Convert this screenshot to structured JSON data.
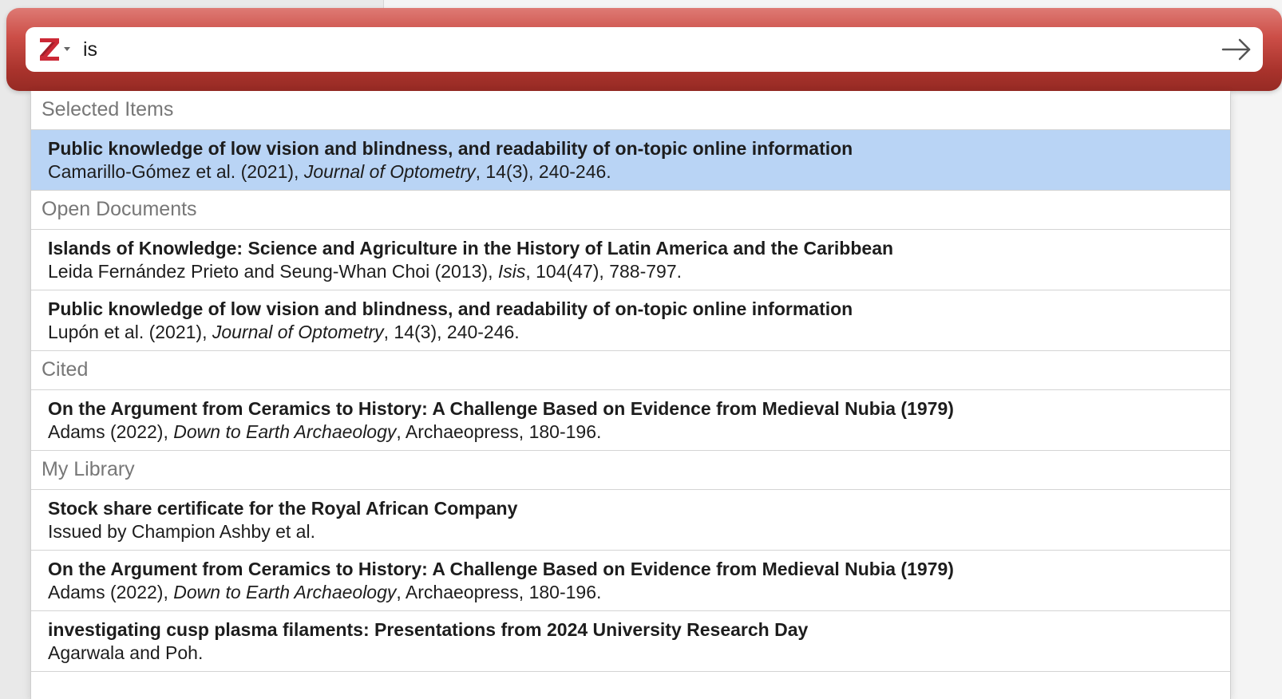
{
  "search": {
    "value": "is"
  },
  "sections": [
    {
      "header": "Selected Items",
      "items": [
        {
          "title": "Public knowledge of low vision and blindness, and readability of on-topic online information",
          "authors": "Camarillo-Gómez et al. (2021), ",
          "publication": "Journal of Optometry",
          "rest": ", 14(3), 240-246.",
          "selected": true
        }
      ]
    },
    {
      "header": "Open Documents",
      "items": [
        {
          "title": "Islands of Knowledge: Science and Agriculture in the History of Latin America and the Caribbean",
          "authors": "Leida Fernández Prieto and Seung-Whan Choi (2013), ",
          "publication": "Isis",
          "rest": ", 104(47), 788-797."
        },
        {
          "title": "Public knowledge of low vision and blindness, and readability of on-topic online information",
          "authors": "Lupón et al. (2021), ",
          "publication": "Journal of Optometry",
          "rest": ", 14(3), 240-246."
        }
      ]
    },
    {
      "header": "Cited",
      "items": [
        {
          "title": "On the Argument from Ceramics to History: A Challenge Based on Evidence from Medieval Nubia (1979)",
          "authors": "Adams (2022), ",
          "publication": "Down to Earth Archaeology",
          "rest": ", Archaeopress, 180-196."
        }
      ]
    },
    {
      "header": "My Library",
      "items": [
        {
          "title": "Stock share certificate for the Royal African Company",
          "authors": "Issued by Champion Ashby et al.",
          "publication": "",
          "rest": ""
        },
        {
          "title": "On the Argument from Ceramics to History: A Challenge Based on Evidence from Medieval Nubia (1979)",
          "authors": "Adams (2022), ",
          "publication": "Down to Earth Archaeology",
          "rest": ", Archaeopress, 180-196."
        },
        {
          "title": "investigating cusp plasma filaments: Presentations from 2024 University Research Day",
          "authors": "Agarwala and Poh.",
          "publication": "",
          "rest": ""
        }
      ]
    }
  ],
  "icons": {
    "logo": "zotero-logo-icon",
    "menu": "chevron-down-icon",
    "submit": "arrow-right-icon"
  },
  "colors": {
    "bar_top": "#de7a74",
    "bar_bottom": "#962a24",
    "logo_red": "#cc2936",
    "selected_row": "#b9d4f5"
  }
}
